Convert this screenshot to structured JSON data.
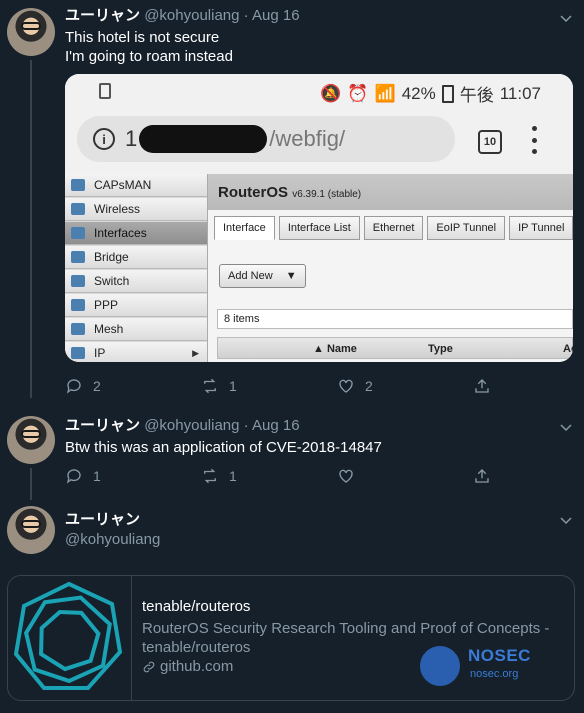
{
  "tweets": [
    {
      "name": "ユーリャン",
      "handle": "@kohyouliang",
      "sep": "·",
      "date": "Aug 16",
      "text_lines": [
        "This hotel is not secure",
        "I'm going to roam instead"
      ],
      "replies": "2",
      "retweets": "1",
      "likes": "2"
    },
    {
      "name": "ユーリャン",
      "handle": "@kohyouliang",
      "sep": "·",
      "date": "Aug 16",
      "text": "Btw this was an application of CVE-2018-14847",
      "replies": "1",
      "retweets": "1",
      "likes": ""
    },
    {
      "name": "ユーリャン",
      "handle": "@kohyouliang"
    }
  ],
  "screenshot": {
    "status": {
      "battery": "42%",
      "time_prefix": "午後",
      "time": "11:07"
    },
    "url": {
      "prefix": "1",
      "path": "/webfig/"
    },
    "tab_count": "10",
    "sidebar": [
      {
        "label": "CAPsMAN",
        "active": false
      },
      {
        "label": "Wireless",
        "active": false
      },
      {
        "label": "Interfaces",
        "active": true
      },
      {
        "label": "Bridge",
        "active": false
      },
      {
        "label": "Switch",
        "active": false
      },
      {
        "label": "PPP",
        "active": false
      },
      {
        "label": "Mesh",
        "active": false
      },
      {
        "label": "IP",
        "active": false,
        "arrow": "▶"
      }
    ],
    "app_title": "RouterOS",
    "app_version": "v6.39.1 (stable)",
    "tabs": [
      "Interface",
      "Interface List",
      "Ethernet",
      "EoIP Tunnel",
      "IP Tunnel"
    ],
    "add_new": "Add New",
    "dropdown_glyph": "▼",
    "items_count": "8 items",
    "columns": [
      "▲ Name",
      "Type",
      "Ac"
    ]
  },
  "card": {
    "title": "tenable/routeros",
    "description": "RouterOS Security Research Tooling and Proof of Concepts - tenable/routeros",
    "domain": "github.com",
    "logo_name": "NOSEC",
    "logo_domain": "nosec.org"
  },
  "colors": {
    "background": "#15202b",
    "muted": "#8899a6",
    "divider": "#38444d",
    "brand": "#3a7bd5"
  }
}
